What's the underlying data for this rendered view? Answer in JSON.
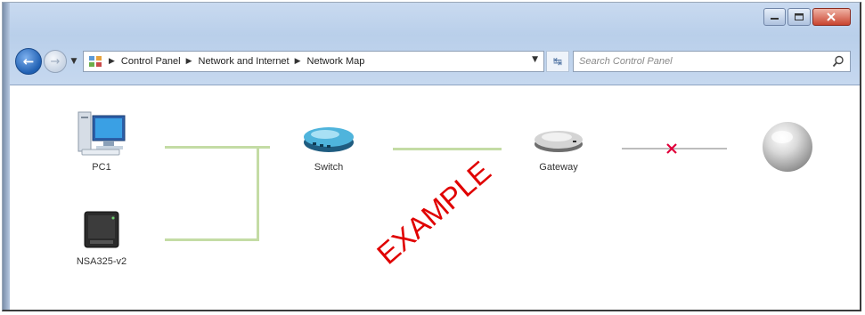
{
  "window": {
    "caption": {
      "minimize_icon": "minimize-icon",
      "maximize_icon": "maximize-icon",
      "close_icon": "close-icon"
    }
  },
  "navigation": {
    "breadcrumbs": [
      "Control Panel",
      "Network and Internet",
      "Network Map"
    ],
    "search_placeholder": "Search Control Panel"
  },
  "network_map": {
    "devices": [
      {
        "label": "PC1",
        "icon": "computer-icon"
      },
      {
        "label": "NSA325-v2",
        "icon": "nas-icon"
      },
      {
        "label": "Switch",
        "icon": "switch-icon"
      },
      {
        "label": "Gateway",
        "icon": "gateway-icon"
      },
      {
        "label": "",
        "icon": "internet-globe-icon"
      }
    ],
    "connection_colors": {
      "ok": "#c4dca5",
      "broken": "#bdbdbd",
      "broken_mark": "#e0003a"
    }
  },
  "watermark": {
    "text": "EXAMPLE",
    "color": "#e00000"
  }
}
